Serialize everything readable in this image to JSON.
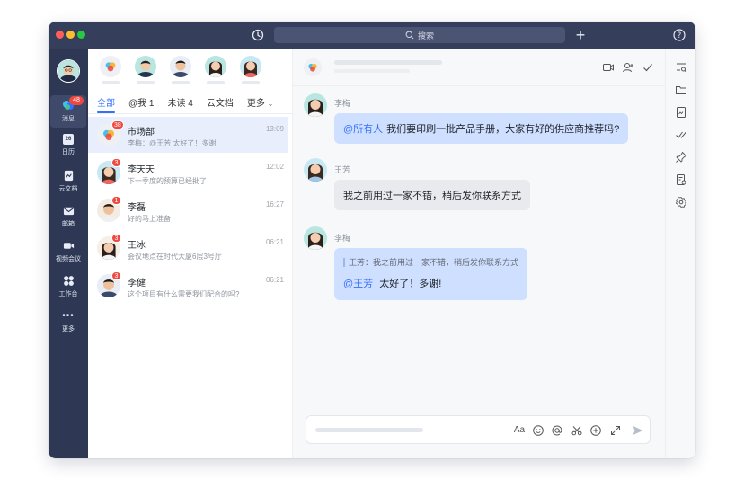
{
  "titlebar": {
    "search_placeholder": "搜索"
  },
  "nav": {
    "items": [
      {
        "label": "消息",
        "icon": "message-icon",
        "badge": "48"
      },
      {
        "label": "日历",
        "icon": "calendar-icon",
        "date": "26"
      },
      {
        "label": "云文档",
        "icon": "doc-icon"
      },
      {
        "label": "邮箱",
        "icon": "mail-icon"
      },
      {
        "label": "视频会议",
        "icon": "video-icon"
      },
      {
        "label": "工作台",
        "icon": "apps-icon"
      },
      {
        "label": "更多",
        "icon": "more-icon"
      }
    ]
  },
  "tabs": [
    "全部",
    "@我 1",
    "未读 4",
    "云文档",
    "更多"
  ],
  "conversations": [
    {
      "name": "市场部",
      "preview": "李梅：@王芳 太好了！多谢",
      "time": "13:09",
      "badge": "38"
    },
    {
      "name": "李天天",
      "preview": "下一季度的预算已经批了",
      "time": "12:02",
      "badge": "3"
    },
    {
      "name": "李磊",
      "preview": "好的马上准备",
      "time": "16:27",
      "badge": "1"
    },
    {
      "name": "王冰",
      "preview": "会议地点在时代大厦6层3号厅",
      "time": "06:21",
      "badge": "3"
    },
    {
      "name": "李健",
      "preview": "这个项目有什么需要我们配合的吗?",
      "time": "06:21",
      "badge": "3"
    }
  ],
  "messages": [
    {
      "sender": "李梅",
      "mention": "@所有人",
      "text": "我们要印刷一批产品手册，大家有好的供应商推荐吗?"
    },
    {
      "sender": "王芳",
      "text": "我之前用过一家不错，稍后发你联系方式"
    },
    {
      "sender": "李梅",
      "quote": "王芳：我之前用过一家不错，稍后发你联系方式",
      "mention": "@王芳",
      "text": "太好了！多谢!"
    }
  ],
  "composer": {
    "font_label": "Aa"
  },
  "colors": {
    "accent": "#3370ff",
    "titlebar": "#353f5c",
    "sidebar": "#2e3854",
    "badge": "#f0473f"
  }
}
